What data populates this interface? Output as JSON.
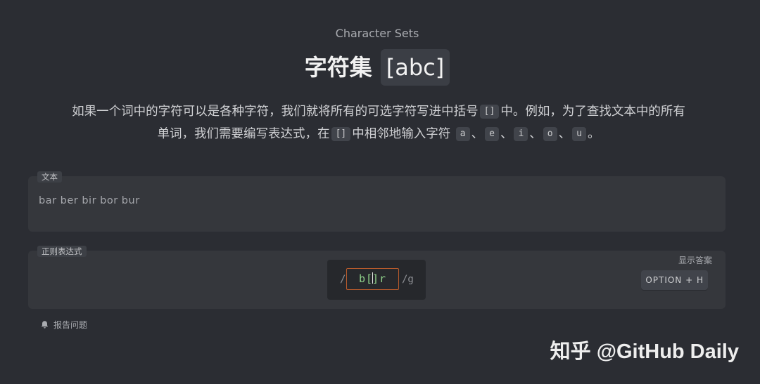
{
  "header": {
    "subtitle": "Character Sets",
    "title": "字符集",
    "title_badge": "[abc]"
  },
  "description": {
    "line1_a": "如果一个词中的字符可以是各种字符，我们就将所有的可选字符写进中括号",
    "chip_brackets_1": "[]",
    "line1_b": "中。例如，为了查找文本中的所有",
    "line2_a": "单词，我们需要编写表达式，在",
    "chip_brackets_2": "[]",
    "line2_b": "中相邻地输入字符",
    "chars": [
      "a",
      "e",
      "i",
      "o",
      "u"
    ],
    "separator": "、",
    "end": "。"
  },
  "text_panel": {
    "label": "文本",
    "content": "bar ber bir bor bur"
  },
  "regex_panel": {
    "label": "正则表达式",
    "open_slash": "/",
    "value_before_caret": "b[",
    "value_after_caret": "]r",
    "flags": "/g",
    "show_answer_label": "显示答案",
    "shortcut_button": "OPTION + H"
  },
  "footer": {
    "report_label": "报告问题"
  },
  "watermark": "知乎 @GitHub Daily"
}
